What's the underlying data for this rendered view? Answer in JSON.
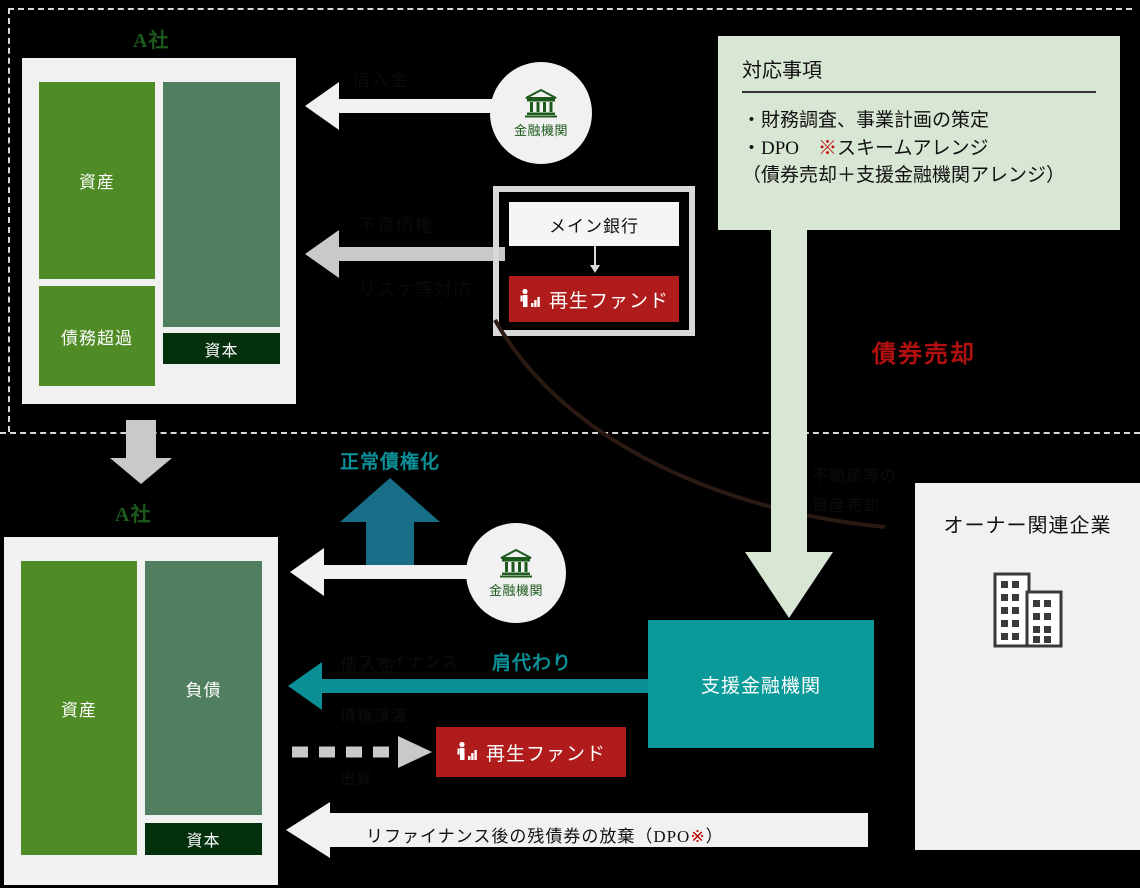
{
  "diagram": {
    "top_section": {
      "company_label": "A社",
      "balance_sheet": {
        "asset_label": "資産",
        "excess_debt_label": "債務超過",
        "liability_label": "",
        "equity_label": "資本"
      },
      "bank_circle": {
        "icon": "bank-icon",
        "caption": "金融機関"
      },
      "arrow_top_label": "借入金",
      "arrow_mid_label_upper": "不良債権",
      "arrow_mid_label_lower": "リスケ等対応",
      "main_bank_box": {
        "label": "メイン銀行",
        "fund_label": "再生ファンド",
        "fund_icon": "person-chart-icon"
      },
      "debt_sale_label": "債券売却",
      "task_panel": {
        "title": "対応事項",
        "items": [
          "・財務調査、事業計画の策定",
          "・DPO　※スキームアレンジ",
          "（債券売却＋支援金融機関アレンジ）"
        ]
      }
    },
    "bottom_section": {
      "company_label": "A社",
      "balance_sheet": {
        "asset_label": "資産",
        "liability_label": "負債",
        "equity_label": "資本"
      },
      "normalization_label": "正常債権化",
      "bank_circle": {
        "icon": "bank-icon",
        "caption": "金融機関"
      },
      "arrow_bank_label": "借入金",
      "takeover_label": "肩代わり",
      "refinance_label_upper": "リファイナンス",
      "refinance_label_lower": "債権譲渡",
      "investment_label": "出資",
      "fund_box": {
        "label": "再生ファンド",
        "icon": "person-chart-icon"
      },
      "support_bank_label": "支援金融機関",
      "bottom_band_label": "リファイナンス後の残債券の放棄（DPO※）",
      "bottom_band_mark": "※",
      "owner_panel": {
        "title": "オーナー関連企業",
        "icon": "building-icon"
      },
      "sale_flow_label_upper": "不動産等の",
      "sale_flow_label_lower": "資産売却"
    }
  },
  "colors": {
    "asset": "#4f8c26",
    "liability": "#4f7f5e",
    "equity": "#04300e",
    "fund_red": "#b01c1c",
    "support_teal": "#0b9a9a",
    "accent_teal": "#0b8f96",
    "panel_green": "#d8e6d4",
    "dark_green_text": "#1d5a1d",
    "red_text": "#b01010",
    "white_panel": "#f1f1f1"
  }
}
